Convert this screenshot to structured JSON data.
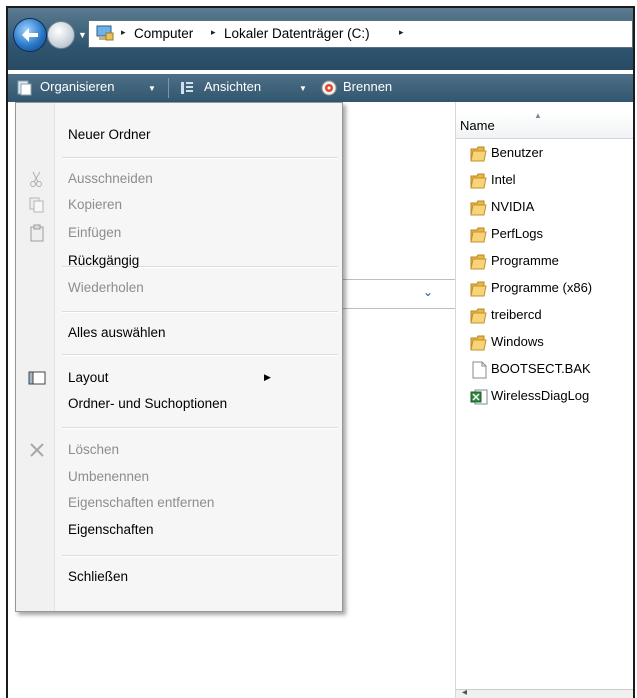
{
  "address_bar": {
    "breadcrumbs": [
      "Computer",
      "Lokaler Datenträger (C:)"
    ],
    "separator": "▸"
  },
  "toolbar": {
    "organize_label": "Organisieren",
    "views_label": "Ansichten",
    "burn_label": "Brennen"
  },
  "file_list": {
    "column_header": "Name",
    "items": [
      {
        "name": "Benutzer",
        "type": "folder"
      },
      {
        "name": "Intel",
        "type": "folder"
      },
      {
        "name": "NVIDIA",
        "type": "folder"
      },
      {
        "name": "PerfLogs",
        "type": "folder"
      },
      {
        "name": "Programme",
        "type": "folder"
      },
      {
        "name": "Programme (x86)",
        "type": "folder"
      },
      {
        "name": "treibercd",
        "type": "folder"
      },
      {
        "name": "Windows",
        "type": "folder"
      },
      {
        "name": "BOOTSECT.BAK",
        "type": "file"
      },
      {
        "name": "WirelessDiagLog",
        "type": "spreadsheet"
      }
    ]
  },
  "menu": {
    "items": [
      {
        "label": "Neuer Ordner",
        "enabled": true
      },
      {
        "label": "Ausschneiden",
        "enabled": false,
        "icon": "scissors-icon"
      },
      {
        "label": "Kopieren",
        "enabled": false,
        "icon": "copy-icon"
      },
      {
        "label": "Einfügen",
        "enabled": false,
        "icon": "paste-icon"
      },
      {
        "label": "Rückgängig",
        "enabled": true
      },
      {
        "label": "Wiederholen",
        "enabled": false
      },
      {
        "label": "Alles auswählen",
        "enabled": true
      },
      {
        "label": "Layout",
        "enabled": true,
        "icon": "layout-icon",
        "submenu": true
      },
      {
        "label": "Ordner- und Suchoptionen",
        "enabled": true
      },
      {
        "label": "Löschen",
        "enabled": false,
        "icon": "delete-x-icon"
      },
      {
        "label": "Umbenennen",
        "enabled": false
      },
      {
        "label": "Eigenschaften entfernen",
        "enabled": false
      },
      {
        "label": "Eigenschaften",
        "enabled": true
      },
      {
        "label": "Schließen",
        "enabled": true
      }
    ]
  },
  "colors": {
    "toolbar": "#3b6078",
    "disabled_text": "#8d8d8d",
    "folder": "#e8b23a"
  }
}
